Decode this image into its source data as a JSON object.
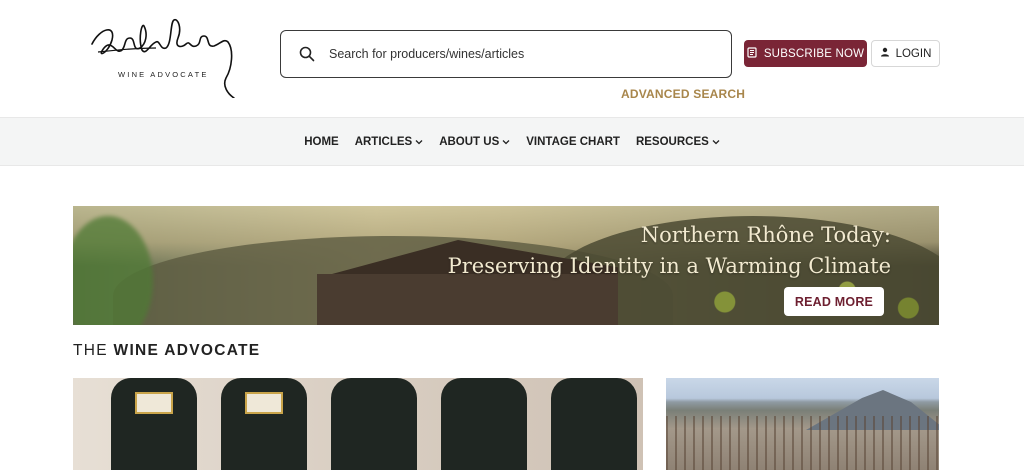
{
  "header": {
    "logo_signature": "Robert Parker",
    "logo_subtitle": "WINE ADVOCATE",
    "search_placeholder": "Search for producers/wines/articles",
    "advanced_search": "ADVANCED SEARCH",
    "subscribe_label": "SUBSCRIBE NOW",
    "login_label": "LOGIN"
  },
  "nav": {
    "items": [
      {
        "label": "HOME",
        "dropdown": false
      },
      {
        "label": "ARTICLES",
        "dropdown": true
      },
      {
        "label": "ABOUT US",
        "dropdown": true
      },
      {
        "label": "VINTAGE CHART",
        "dropdown": false
      },
      {
        "label": "RESOURCES",
        "dropdown": true
      }
    ]
  },
  "banner": {
    "headline_line1": "Northern Rhône Today:",
    "headline_line2": "Preserving Identity in a Warming Climate",
    "cta": "READ MORE"
  },
  "section": {
    "title_light": "THE",
    "title_bold": "WINE ADVOCATE"
  },
  "colors": {
    "accent_burgundy": "#7a2536",
    "gold_link": "#a8864b",
    "nav_bg": "#f4f5f5"
  }
}
